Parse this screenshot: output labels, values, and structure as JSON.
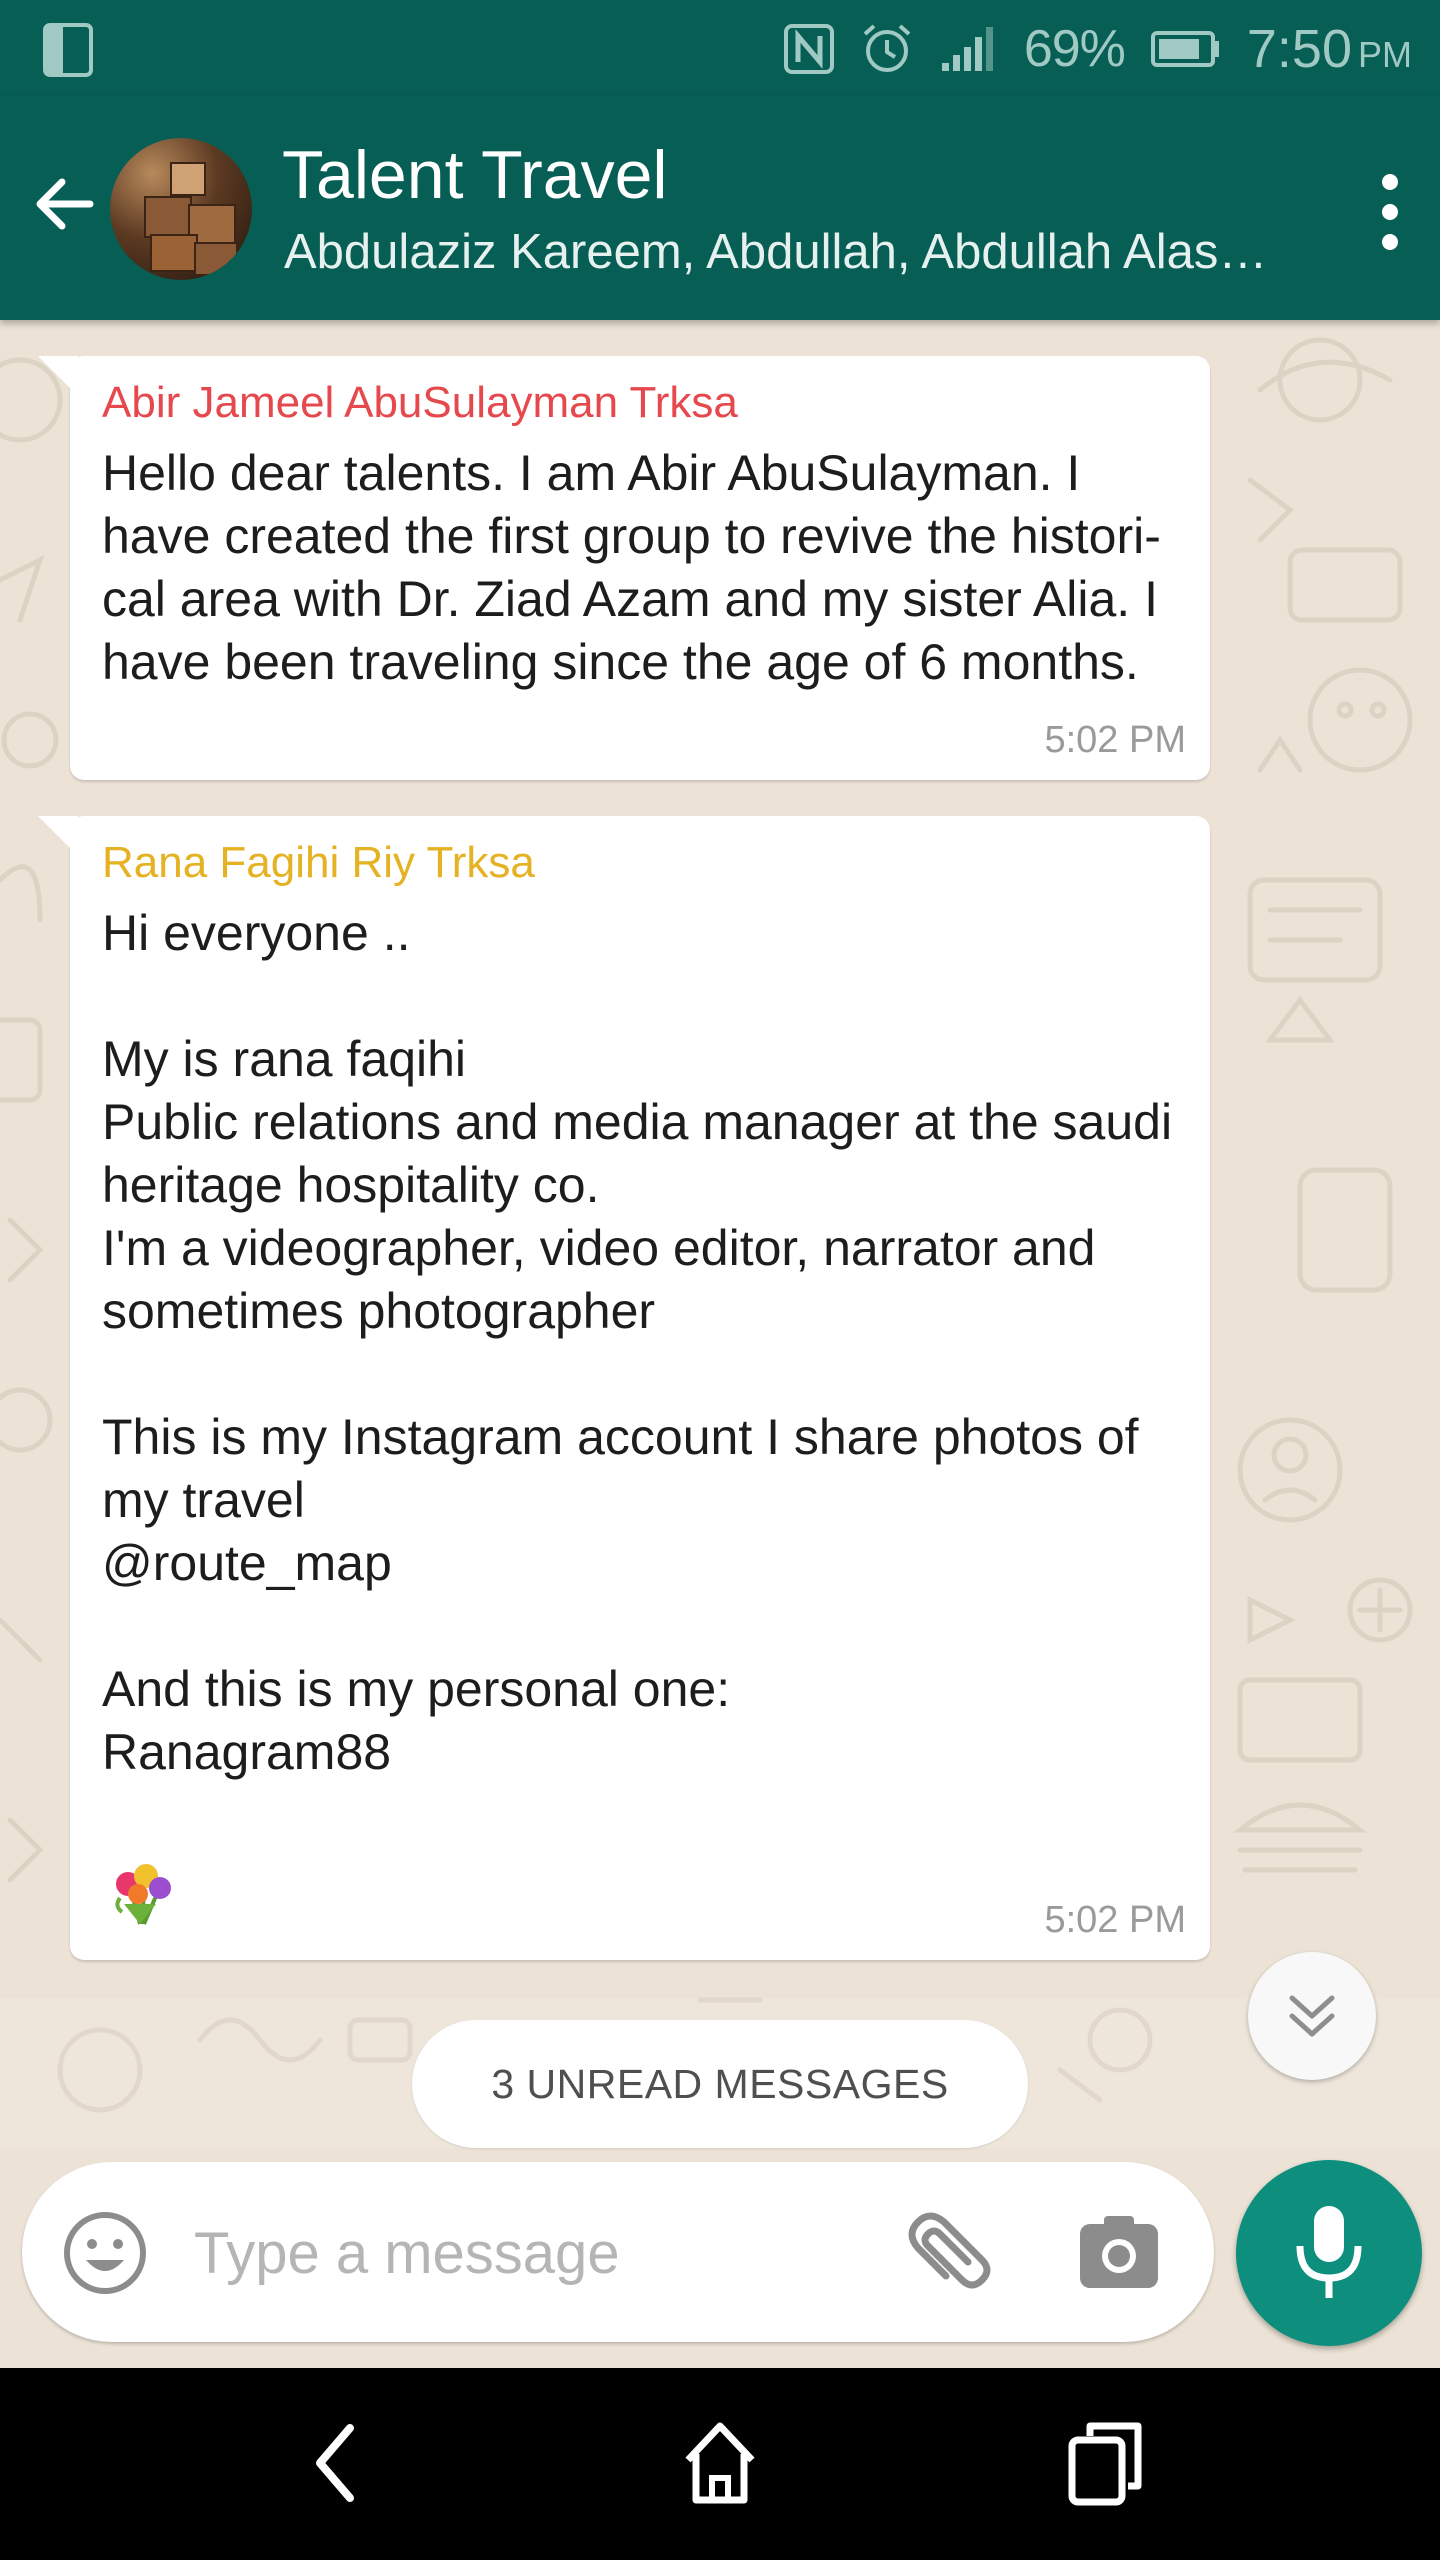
{
  "status_bar": {
    "battery_percent": "69%",
    "time": "7:50",
    "ampm": "PM",
    "icons": [
      "dual-window-icon",
      "nfc-icon",
      "alarm-icon",
      "signal-icon",
      "battery-icon"
    ]
  },
  "header": {
    "title": "Talent Travel",
    "subtitle": "Abdulaziz Kareem, Abdullah, Abdullah Alas…",
    "colors": {
      "bar": "#075e54"
    }
  },
  "messages": [
    {
      "sender": "Abir Jameel AbuSulayman Trksa",
      "sender_color": "#e5484d",
      "text": "Hello dear talents. I am Abir AbuSulayman. I\nhave created the first group to revive the histori-\ncal area with Dr. Ziad Azam and my sister Alia. I\nhave been traveling since the age of 6 months.",
      "time": "5:02 PM"
    },
    {
      "sender": "Rana Fagihi Riy Trksa",
      "sender_color": "#e5b224",
      "text": "Hi everyone ..\n\nMy is rana faqihi\nPublic relations and media manager at the saudi\nheritage hospitality co.\nI'm a videographer, video editor, narrator and\nsometimes photographer\n\nThis is my Instagram account I share photos of\nmy travel\n@route_map\n\nAnd this is my personal one:\nRanagram88",
      "emoji": "bouquet-icon",
      "time": "5:02 PM"
    }
  ],
  "unread_banner": "3 UNREAD MESSAGES",
  "composer": {
    "placeholder": "Type a message",
    "value": ""
  },
  "colors": {
    "accent": "#0e8f7e",
    "chat_background": "#ece3d6",
    "bubble": "#ffffff"
  }
}
